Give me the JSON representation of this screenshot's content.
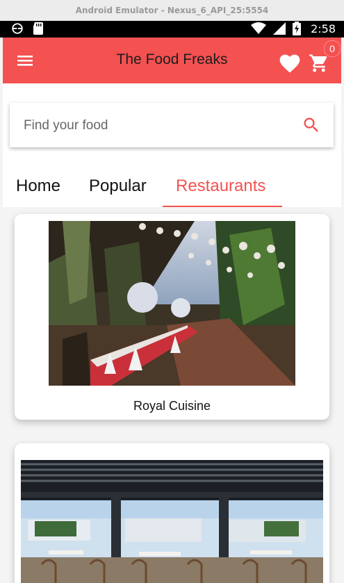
{
  "window": {
    "title": "Android Emulator - Nexus_6_API_25:5554"
  },
  "status_bar": {
    "time": "2:58",
    "left_icons": [
      "sync-icon",
      "sd-card-icon"
    ],
    "right_icons": [
      "wifi-icon",
      "signal-icon",
      "battery-charging-icon"
    ]
  },
  "app_bar": {
    "title": "The Food Freaks",
    "cart_count": "0",
    "accent_color": "#f45151"
  },
  "search": {
    "placeholder": "Find your food",
    "value": ""
  },
  "tabs": [
    {
      "label": "Home",
      "active": false
    },
    {
      "label": "Popular",
      "active": false
    },
    {
      "label": "Restaurants",
      "active": true
    }
  ],
  "restaurants": [
    {
      "name": "Royal Cuisine",
      "image": "restaurant-photo"
    },
    {
      "name": "",
      "image": "restaurant-photo"
    }
  ]
}
